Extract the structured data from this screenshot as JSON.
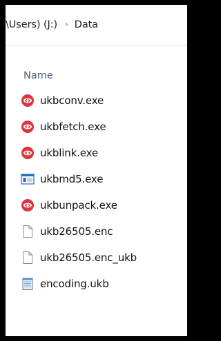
{
  "addressbar": {
    "path": "\\Users) (J:)",
    "separator": "›",
    "folder": "Data"
  },
  "columns": {
    "name": "Name"
  },
  "files": [
    {
      "name": "ukbconv.exe",
      "icon": "red-app-icon"
    },
    {
      "name": "ukbfetch.exe",
      "icon": "red-app-icon"
    },
    {
      "name": "ukblink.exe",
      "icon": "red-app-icon"
    },
    {
      "name": "ukbmd5.exe",
      "icon": "window-app-icon"
    },
    {
      "name": "ukbunpack.exe",
      "icon": "red-app-icon"
    },
    {
      "name": "ukb26505.enc",
      "icon": "blank-file-icon"
    },
    {
      "name": "ukb26505.enc_ukb",
      "icon": "blank-file-icon"
    },
    {
      "name": "encoding.ukb",
      "icon": "notepad-file-icon"
    }
  ],
  "colors": {
    "header_text": "#4c607a",
    "red_app": "#d9363e",
    "window_blue": "#1f6fc5"
  }
}
